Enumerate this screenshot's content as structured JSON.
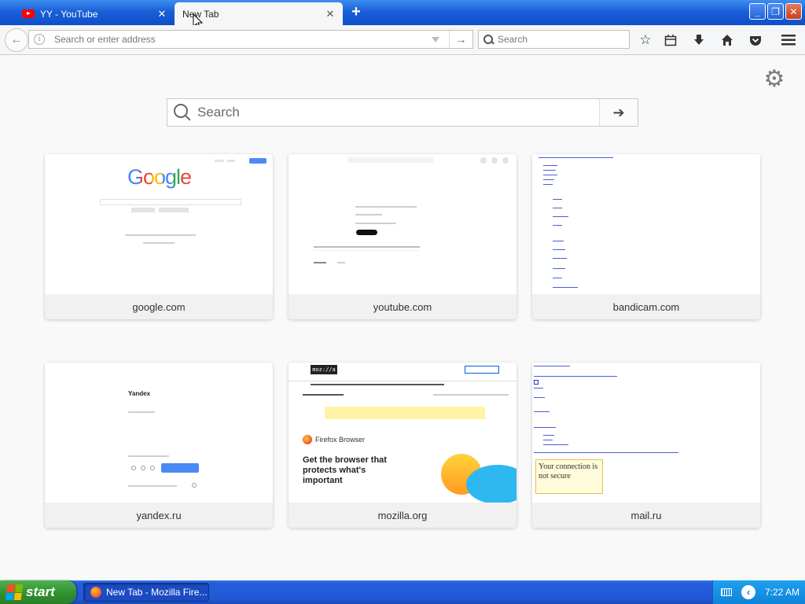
{
  "tabs": [
    {
      "title": "YY - YouTube",
      "active": false
    },
    {
      "title": "New Tab",
      "active": true
    }
  ],
  "navbar": {
    "url_placeholder": "Search or enter address",
    "search_placeholder": "Search"
  },
  "newtab": {
    "search_placeholder": "Search",
    "tiles": [
      {
        "label": "google.com"
      },
      {
        "label": "youtube.com"
      },
      {
        "label": "bandicam.com"
      },
      {
        "label": "yandex.ru"
      },
      {
        "label": "mozilla.org"
      },
      {
        "label": "mail.ru"
      }
    ],
    "thumb_text": {
      "google_logo": "Google",
      "yandex_logo": "Yandex",
      "mozilla_logo": "moz://a",
      "mozilla_brand": "Firefox Browser",
      "mozilla_headline": "Get the browser that protects what's important",
      "mail_box": "Your connection is not secure"
    }
  },
  "taskbar": {
    "start_label": "start",
    "task_label": "New Tab - Mozilla Fire...",
    "clock": "7:22 AM"
  },
  "colors": {
    "titlebar": "#1a5fd8",
    "taskbar": "#245edb",
    "start_green": "#2f8e2e",
    "youtube_red": "#ff0000"
  }
}
